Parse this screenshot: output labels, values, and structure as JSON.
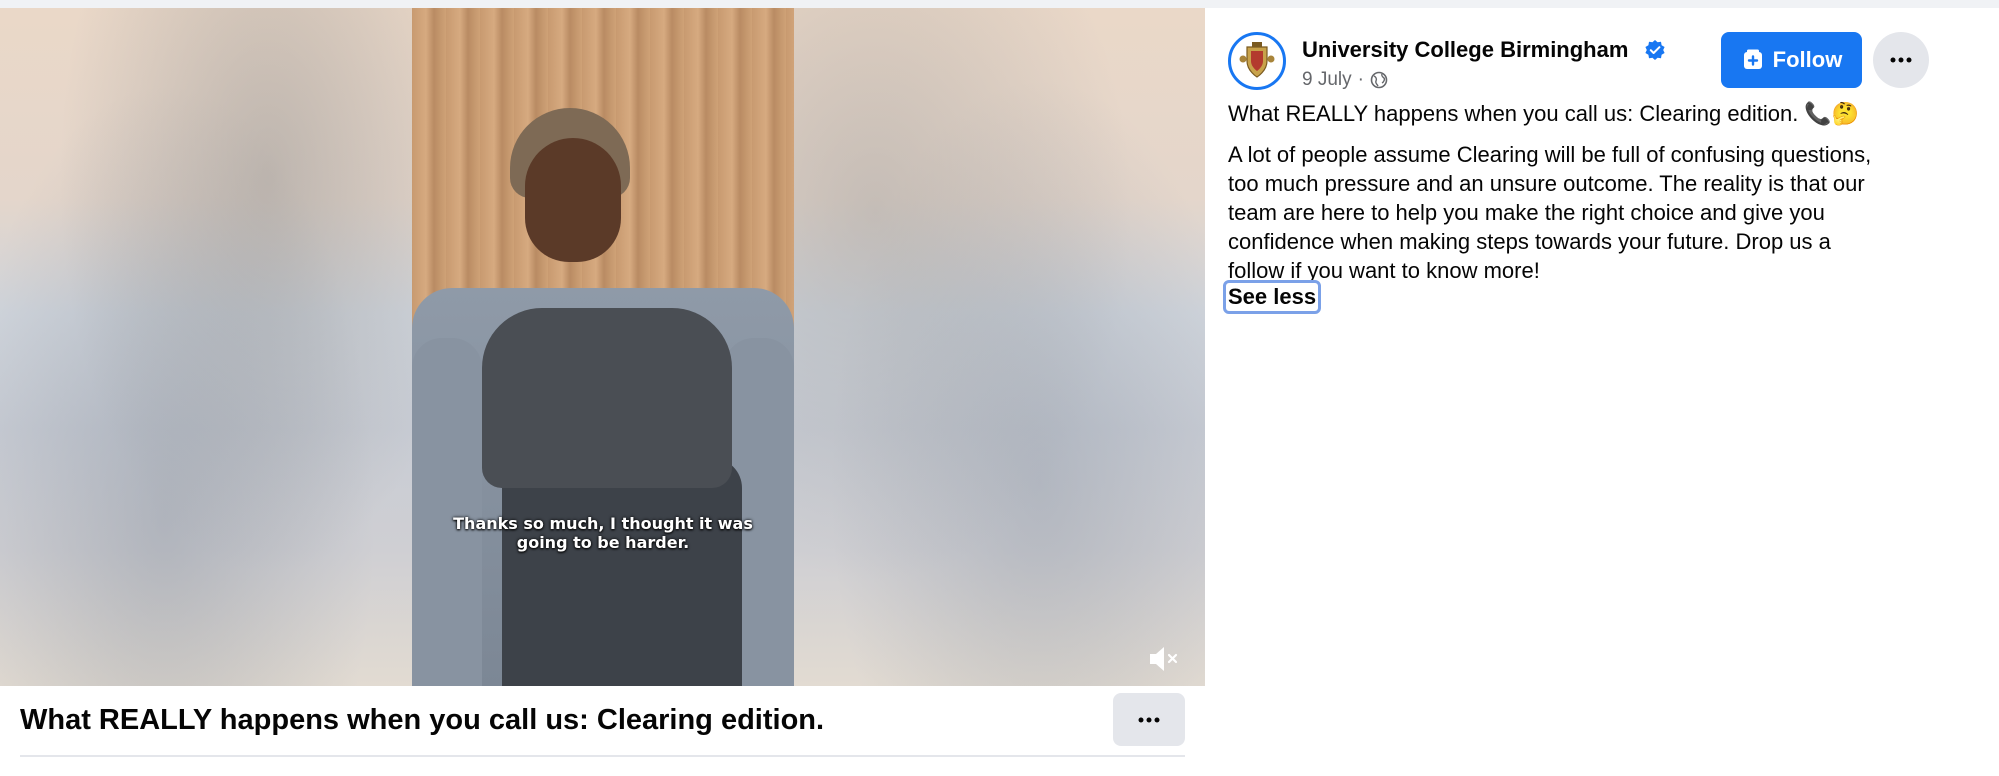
{
  "video": {
    "caption_line1": "Thanks so much, I thought it was",
    "caption_line2": "going to be harder.",
    "title": "What REALLY happens when you call us: Clearing edition.",
    "mute_icon": "speaker-muted-icon",
    "more_icon": "ellipsis-icon"
  },
  "post": {
    "page_name": "University College Birmingham",
    "verified_icon": "verified-badge-icon",
    "date": "9 July",
    "separator": "·",
    "audience_icon": "globe-icon",
    "follow_label": "Follow",
    "follow_icon": "add-page-icon",
    "more_icon": "ellipsis-icon",
    "title": "What REALLY happens when you call us: Clearing edition. 📞🤔",
    "body_lines": [
      "A lot of people assume Clearing will be full of confusing questions,",
      "too much pressure and an unsure outcome. The reality is that our",
      "team are here to help you make the right choice and give you",
      "confidence when making steps towards your future. Drop us a",
      "follow if you want to know more!"
    ],
    "see_less_label": "See less"
  },
  "colors": {
    "brand_blue": "#1877f2",
    "secondary_button": "#e4e6eb",
    "meta_text": "#65676b"
  }
}
